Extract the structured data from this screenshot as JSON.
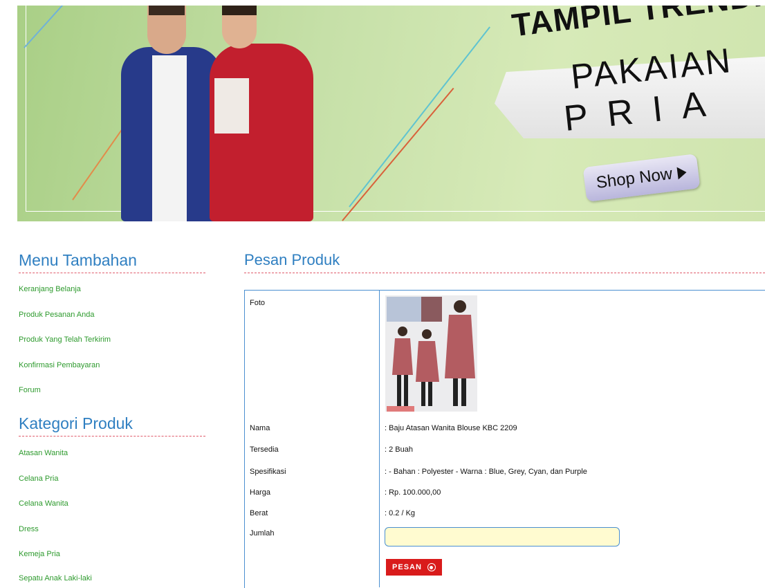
{
  "banner": {
    "headline": "TAMPIL TRENDI",
    "line1": "PAKAIAN",
    "line2": "PRIA",
    "cta": "Shop Now"
  },
  "sidebar": {
    "menu_title": "Menu Tambahan",
    "menu_items": [
      {
        "label": "Keranjang Belanja"
      },
      {
        "label": "Produk Pesanan Anda"
      },
      {
        "label": "Produk Yang Telah Terkirim"
      },
      {
        "label": "Konfirmasi Pembayaran"
      },
      {
        "label": "Forum"
      }
    ],
    "category_title": "Kategori Produk",
    "category_items": [
      {
        "label": "Atasan Wanita"
      },
      {
        "label": "Celana Pria"
      },
      {
        "label": "Celana Wanita"
      },
      {
        "label": "Dress"
      },
      {
        "label": "Kemeja Pria"
      },
      {
        "label": "Sepatu Anak Laki-laki"
      }
    ]
  },
  "main": {
    "title": "Pesan Produk",
    "fields": {
      "foto_label": "Foto",
      "nama_label": "Nama",
      "nama_value": ": Baju Atasan Wanita Blouse KBC 2209",
      "tersedia_label": "Tersedia",
      "tersedia_value": ": 2 Buah",
      "spesifikasi_label": "Spesifikasi",
      "spesifikasi_value": ": - Bahan : Polyester - Warna : Blue, Grey, Cyan, dan Purple",
      "harga_label": "Harga",
      "harga_value": ": Rp. 100.000,00",
      "berat_label": "Berat",
      "berat_value": ": 0.2 / Kg",
      "jumlah_label": "Jumlah",
      "jumlah_value": ""
    },
    "submit_label": "PESAN"
  },
  "colors": {
    "heading": "#2f7fc1",
    "link": "#2d9a2d",
    "button": "#d91b1b",
    "input_bg": "#fffbd0"
  }
}
